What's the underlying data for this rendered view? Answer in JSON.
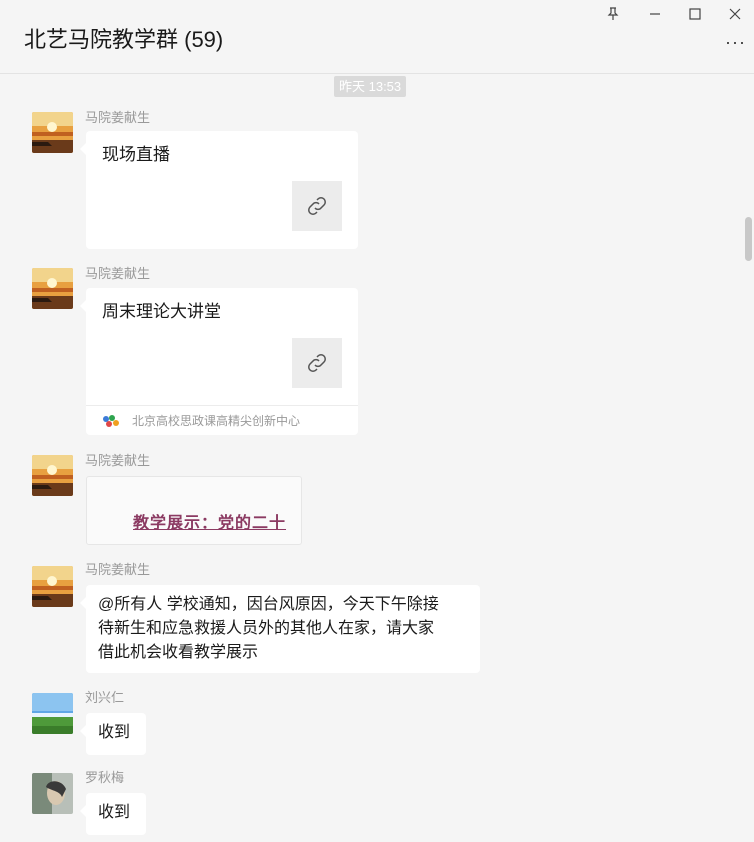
{
  "window": {
    "title": "北艺马院教学群 (59)",
    "controls": {
      "pin_icon": "pin-icon",
      "minimize_icon": "minimize-icon",
      "maximize_icon": "maximize-icon",
      "close_icon": "close-icon"
    },
    "more_label": "···"
  },
  "timestamp": "昨天 13:53",
  "messages": [
    {
      "sender": "马院姜献生",
      "type": "link",
      "title": "现场直播"
    },
    {
      "sender": "马院姜献生",
      "type": "link",
      "title": "周末理论大讲堂",
      "source": "北京高校思政课高精尖创新中心"
    },
    {
      "sender": "马院姜献生",
      "type": "image",
      "image_text": "教学展示：党的二十"
    },
    {
      "sender": "马院姜献生",
      "type": "text",
      "lines": [
        "@所有人 学校通知，因台风原因，今天下午除接",
        "待新生和应急救援人员外的其他人在家，请大家",
        "借此机会收看教学展示"
      ]
    },
    {
      "sender": "刘兴仁",
      "type": "text",
      "text": "收到"
    },
    {
      "sender": "罗秋梅",
      "type": "text",
      "text": "收到"
    }
  ],
  "colors": {
    "background": "#f5f5f5",
    "bubble": "#ffffff",
    "sender_text": "#999999",
    "image_text": "#8b3a62"
  }
}
